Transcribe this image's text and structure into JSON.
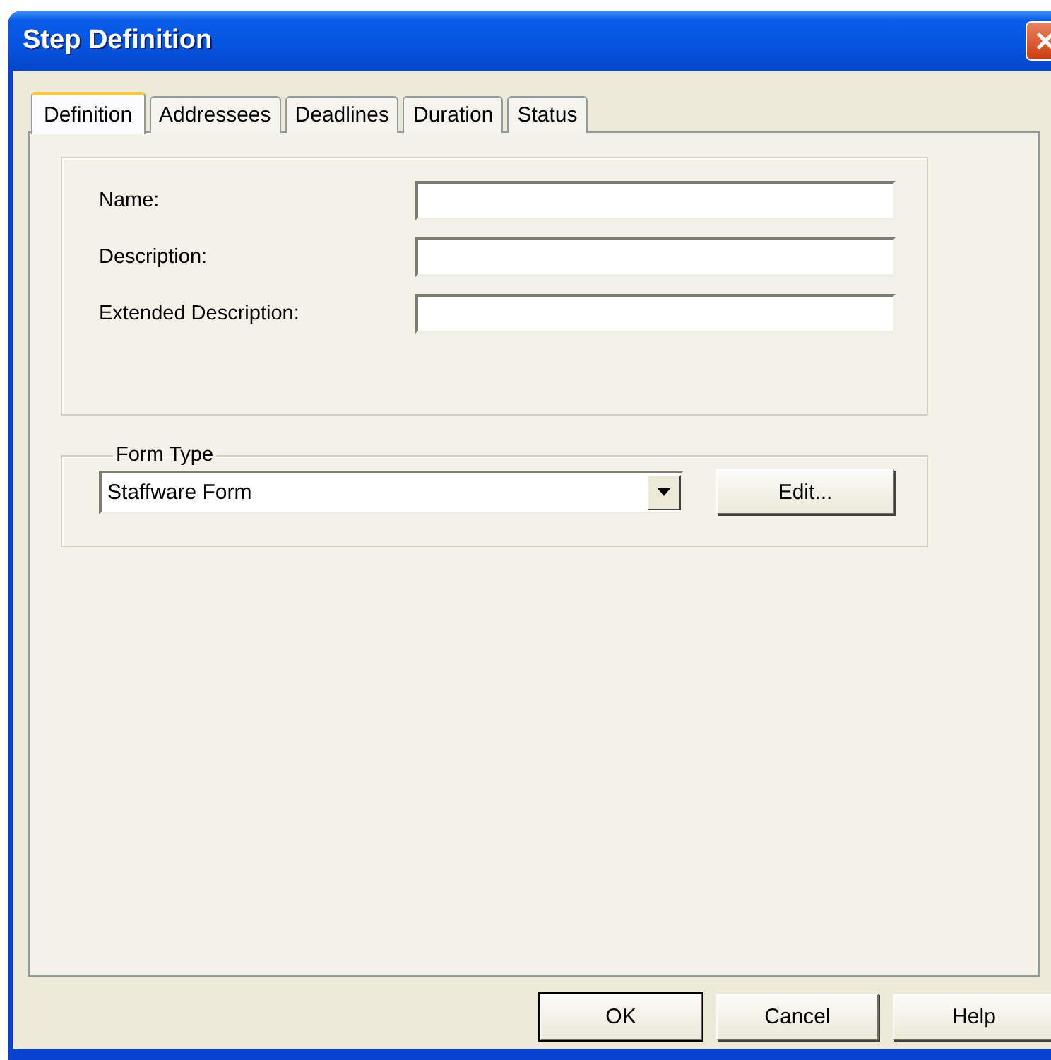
{
  "window": {
    "title": "Step Definition"
  },
  "tabs": [
    {
      "label": "Definition",
      "selected": true
    },
    {
      "label": "Addressees",
      "selected": false
    },
    {
      "label": "Deadlines",
      "selected": false
    },
    {
      "label": "Duration",
      "selected": false
    },
    {
      "label": "Status",
      "selected": false
    }
  ],
  "fields": [
    {
      "label": "Name:"
    },
    {
      "label": "Description:"
    },
    {
      "label": "Extended Description:"
    }
  ],
  "form_type": {
    "legend": "Form Type",
    "value": "Staffware Form",
    "button": "Edit..."
  },
  "buttons": [
    {
      "label": "OK",
      "default": true
    },
    {
      "label": "Cancel",
      "default": false
    },
    {
      "label": "Help",
      "default": false
    }
  ]
}
